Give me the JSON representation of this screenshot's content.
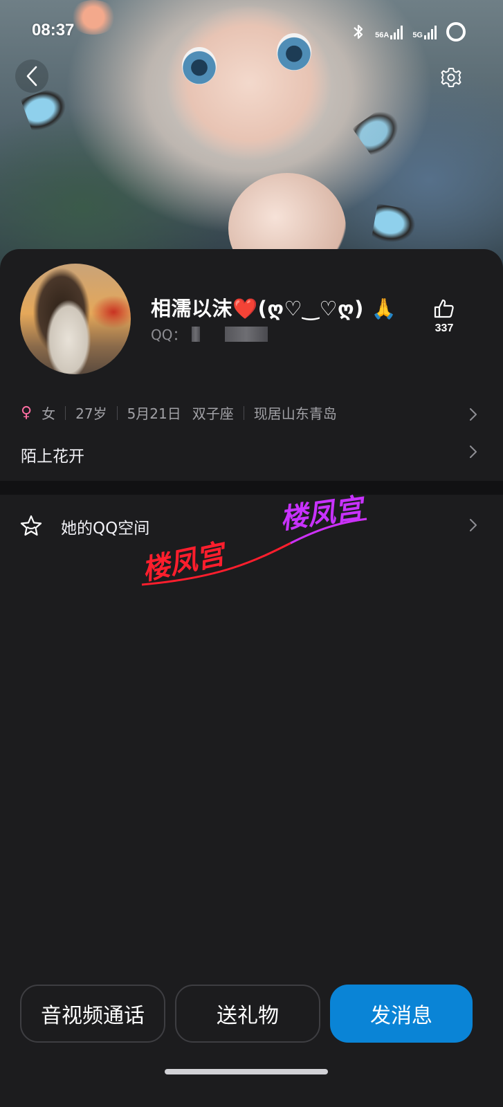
{
  "status_bar": {
    "time": "08:37",
    "bluetooth_icon": "bluetooth-icon",
    "network_1": "56A",
    "network_2": "5G"
  },
  "header": {
    "back_icon": "chevron-left-icon",
    "settings_icon": "gear-icon"
  },
  "profile": {
    "nickname": "相濡以沫❤️(ღ♡‿♡ღ) 🙏",
    "qq_label": "QQ：",
    "likes": "337",
    "gender": "女",
    "age": "27岁",
    "birthday": "5月21日",
    "zodiac": "双子座",
    "location": "现居山东青岛",
    "signature": "陌上花开",
    "gender_color": "#ff6fa3"
  },
  "menu": {
    "qzone_label": "她的QQ空间"
  },
  "watermark": {
    "text_1": "楼凤宫",
    "text_2": "楼凤宫",
    "color_1": "#ff1e2d",
    "color_2": "#c832ff"
  },
  "actions": {
    "call_label": "音视频通话",
    "gift_label": "送礼物",
    "message_label": "发消息",
    "accent_color": "#0a84d6"
  }
}
